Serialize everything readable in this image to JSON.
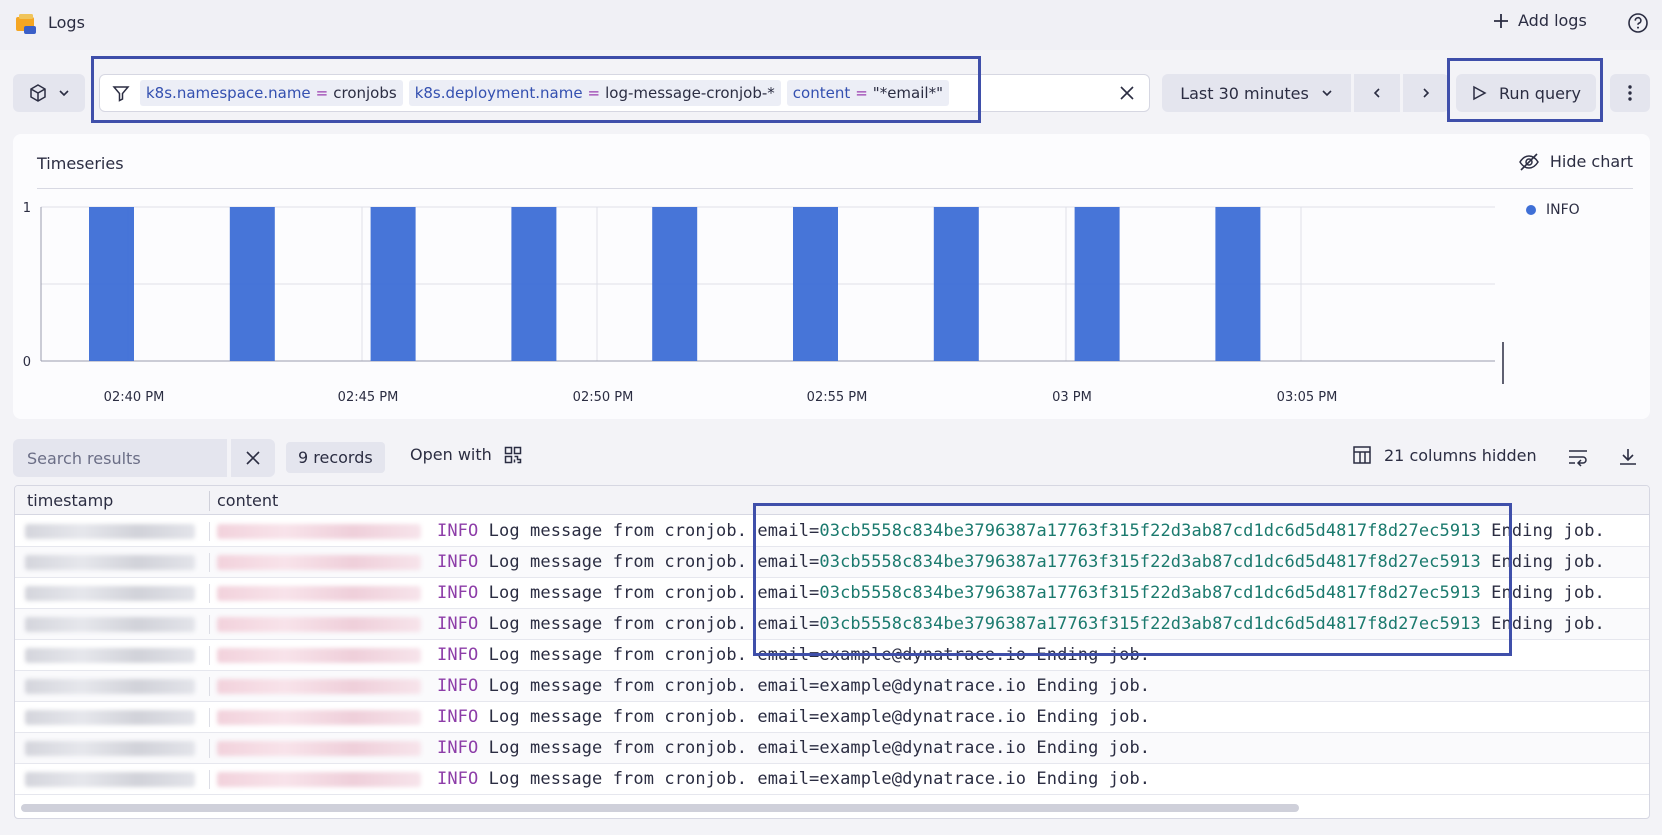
{
  "app": {
    "title": "Logs",
    "add_logs_label": "Add logs"
  },
  "filter": {
    "chips": [
      {
        "key": "k8s.namespace.name",
        "op": "=",
        "value": "cronjobs"
      },
      {
        "key": "k8s.deployment.name",
        "op": "=",
        "value": "log-message-cronjob-*"
      },
      {
        "key": "content",
        "op": "=",
        "value": "\"*email*\""
      }
    ]
  },
  "time": {
    "range_label": "Last 30 minutes"
  },
  "run_query_label": "Run query",
  "chart": {
    "title": "Timeseries",
    "hide_label": "Hide chart",
    "legend": "INFO",
    "color": "#3f6fd6"
  },
  "chart_data": {
    "type": "bar",
    "x_ticks": [
      "02:40 PM",
      "02:45 PM",
      "02:50 PM",
      "02:55 PM",
      "03 PM",
      "03:05 PM"
    ],
    "y_ticks": [
      "0",
      "1"
    ],
    "ylim": [
      0,
      1
    ],
    "series": [
      {
        "name": "INFO",
        "values": [
          1,
          1,
          1,
          1,
          1,
          1,
          1,
          1,
          1
        ]
      }
    ],
    "grid": true
  },
  "results": {
    "search_placeholder": "Search results",
    "records_label": "9 records",
    "open_with_label": "Open with",
    "columns_hidden_label": "21 columns hidden"
  },
  "table": {
    "headers": [
      "timestamp",
      "content"
    ],
    "rows": [
      {
        "level": "INFO",
        "text": " Log message from cronjob. email=",
        "email": "03cb5558c834be3796387a17763f315f22d3ab87cd1dc6d5d4817f8d27ec5913",
        "suffix": " Ending job."
      },
      {
        "level": "INFO",
        "text": " Log message from cronjob. email=",
        "email": "03cb5558c834be3796387a17763f315f22d3ab87cd1dc6d5d4817f8d27ec5913",
        "suffix": " Ending job."
      },
      {
        "level": "INFO",
        "text": " Log message from cronjob. email=",
        "email": "03cb5558c834be3796387a17763f315f22d3ab87cd1dc6d5d4817f8d27ec5913",
        "suffix": " Ending job."
      },
      {
        "level": "INFO",
        "text": " Log message from cronjob. email=",
        "email": "03cb5558c834be3796387a17763f315f22d3ab87cd1dc6d5d4817f8d27ec5913",
        "suffix": " Ending job."
      },
      {
        "level": "INFO",
        "text": " Log message from cronjob. email=example@dynatrace.io Ending job.",
        "email": "",
        "suffix": ""
      },
      {
        "level": "INFO",
        "text": " Log message from cronjob. email=example@dynatrace.io Ending job.",
        "email": "",
        "suffix": ""
      },
      {
        "level": "INFO",
        "text": " Log message from cronjob. email=example@dynatrace.io Ending job.",
        "email": "",
        "suffix": ""
      },
      {
        "level": "INFO",
        "text": " Log message from cronjob. email=example@dynatrace.io Ending job.",
        "email": "",
        "suffix": ""
      },
      {
        "level": "INFO",
        "text": " Log message from cronjob. email=example@dynatrace.io Ending job.",
        "email": "",
        "suffix": ""
      }
    ]
  }
}
